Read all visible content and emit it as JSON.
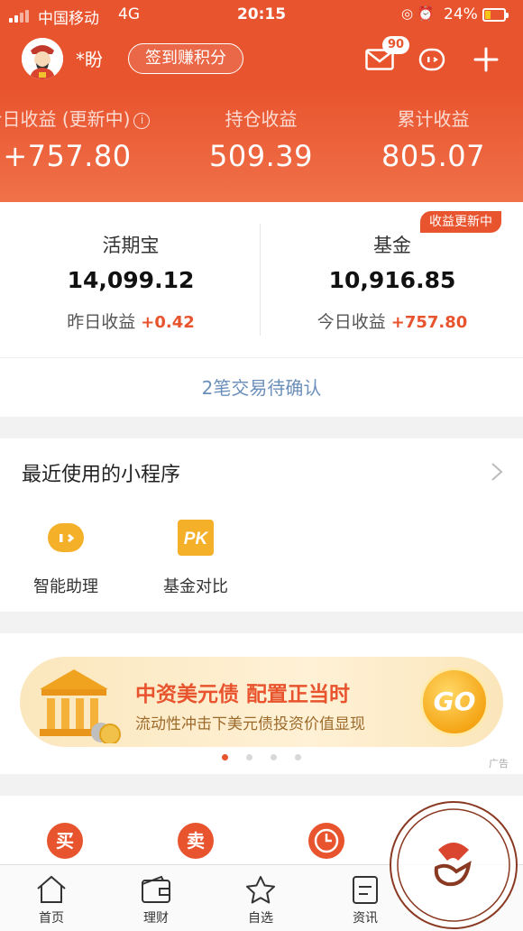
{
  "status_bar": {
    "carrier": "中国移动",
    "network": "4G",
    "time": "20:15",
    "battery": "24%"
  },
  "header": {
    "username": "*盼",
    "signin_label": "签到赚积分",
    "message_count": "90"
  },
  "profit": {
    "today_label": "今日收益 (更新中)",
    "today_value": "+757.80",
    "holding_label": "持仓收益",
    "holding_value": "509.39",
    "total_label": "累计收益",
    "total_value": "805.07"
  },
  "assets": {
    "update_badge": "收益更新中",
    "left": {
      "name": "活期宝",
      "amount": "14,099.12",
      "earn_label": "昨日收益",
      "earn_value": "+0.42"
    },
    "right": {
      "name": "基金",
      "amount": "10,916.85",
      "earn_label": "今日收益",
      "earn_value": "+757.80"
    }
  },
  "pending": {
    "text": "2笔交易待确认"
  },
  "mini_programs": {
    "title": "最近使用的小程序",
    "items": [
      {
        "label": "智能助理",
        "icon": "robot-icon"
      },
      {
        "label": "基金对比",
        "icon": "pk-icon",
        "icon_text": "PK"
      }
    ]
  },
  "ad": {
    "title": "中资美元债 配置正当时",
    "subtitle": "流动性冲击下美元债投资价值显现",
    "go_label": "GO",
    "tag": "广告",
    "slide_count": 4,
    "active_slide": 0
  },
  "trade": {
    "buy": "买",
    "sell": "卖"
  },
  "tabbar": {
    "items": [
      "首页",
      "理财",
      "自选",
      "资讯"
    ]
  },
  "colors": {
    "brand": "#e8542e",
    "link": "#6b8fba",
    "gold": "#f5a617"
  }
}
